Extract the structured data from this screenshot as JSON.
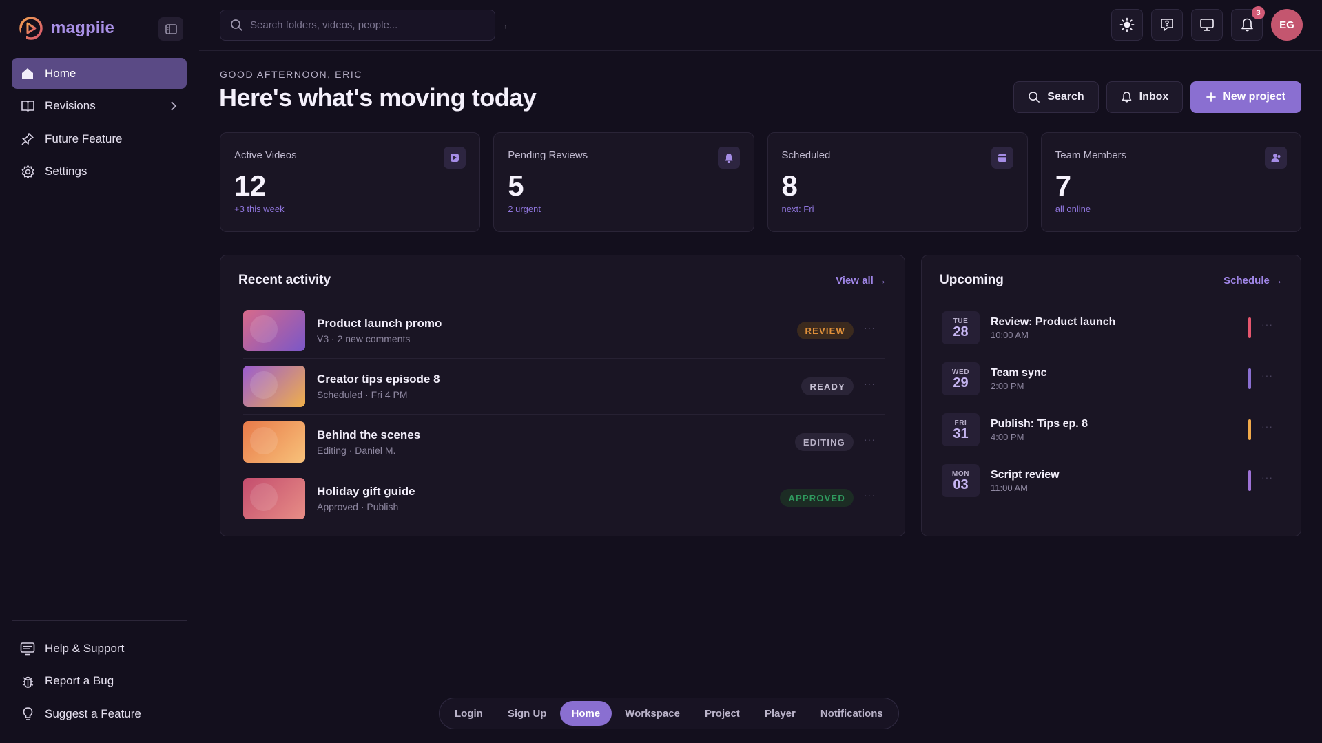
{
  "brand": {
    "name": "magpiie",
    "accent": "#8a6fd1"
  },
  "sidebar": {
    "items": [
      {
        "label": "Home",
        "icon": "home-icon",
        "active": true
      },
      {
        "label": "Revisions",
        "icon": "book-open-icon",
        "active": false,
        "has_children": true
      },
      {
        "label": "Future Feature",
        "icon": "pin-icon",
        "active": false
      },
      {
        "label": "Settings",
        "icon": "gear-icon",
        "active": false
      }
    ],
    "bottom_items": [
      {
        "label": "Help & Support",
        "icon": "monitor-help-icon"
      },
      {
        "label": "Report a Bug",
        "icon": "bug-icon"
      },
      {
        "label": "Suggest a Feature",
        "icon": "lightbulb-icon"
      }
    ]
  },
  "topbar": {
    "search_placeholder": "Search folders, videos, people...",
    "notification_count": "3",
    "avatar_initials": "EG",
    "icons": [
      "sun-icon",
      "help-icon",
      "monitor-icon",
      "bell-icon"
    ]
  },
  "header": {
    "greeting": "GOOD AFTERNOON, ERIC",
    "title": "Here's what's moving today",
    "search_label": "Search",
    "inbox_label": "Inbox",
    "new_project_label": "New project"
  },
  "stats": [
    {
      "label": "Active Videos",
      "value": "12",
      "sub": "+3 this week",
      "icon": "play-icon"
    },
    {
      "label": "Pending Reviews",
      "value": "5",
      "sub": "2 urgent",
      "icon": "bell-icon"
    },
    {
      "label": "Scheduled",
      "value": "8",
      "sub": "next: Fri",
      "icon": "calendar-icon"
    },
    {
      "label": "Team Members",
      "value": "7",
      "sub": "all online",
      "icon": "users-icon"
    }
  ],
  "activity": {
    "title": "Recent activity",
    "view_all": "View all →",
    "items": [
      {
        "title": "Product launch promo",
        "meta": "V3 · 2 new comments",
        "status": "REVIEW",
        "status_color": "#e0903a",
        "status_bg": "#3b2a1e",
        "thumb": [
          "#d86a8a",
          "#7a57c8"
        ]
      },
      {
        "title": "Creator tips episode 8",
        "meta": "Scheduled · Fri 4 PM",
        "status": "READY",
        "status_color": "#c9c3d6",
        "status_bg": "#2a2437",
        "thumb": [
          "#9a5cd0",
          "#f0b04a"
        ]
      },
      {
        "title": "Behind the scenes",
        "meta": "Editing · Daniel M.",
        "status": "EDITING",
        "status_color": "#b7b0c5",
        "status_bg": "#2a2437",
        "thumb": [
          "#e87a4a",
          "#f8c27a"
        ]
      },
      {
        "title": "Holiday gift guide",
        "meta": "Approved · Publish",
        "status": "APPROVED",
        "status_color": "#2f9a5e",
        "status_bg": "#1c2c24",
        "thumb": [
          "#c44d6e",
          "#e78e86"
        ]
      }
    ]
  },
  "upcoming": {
    "title": "Upcoming",
    "link": "Schedule →",
    "items": [
      {
        "dow": "TUE",
        "day": "28",
        "title": "Review: Product launch",
        "time": "10:00 AM",
        "color": "#e5566e"
      },
      {
        "dow": "WED",
        "day": "29",
        "title": "Team sync",
        "time": "2:00 PM",
        "color": "#8a6fd1"
      },
      {
        "dow": "FRI",
        "day": "31",
        "title": "Publish: Tips ep. 8",
        "time": "4:00 PM",
        "color": "#f0a94a"
      },
      {
        "dow": "MON",
        "day": "03",
        "title": "Script review",
        "time": "11:00 AM",
        "color": "#9e72d6"
      }
    ]
  },
  "switcher": {
    "items": [
      "Login",
      "Sign Up",
      "Home",
      "Workspace",
      "Project",
      "Player",
      "Notifications"
    ],
    "active": "Home"
  }
}
